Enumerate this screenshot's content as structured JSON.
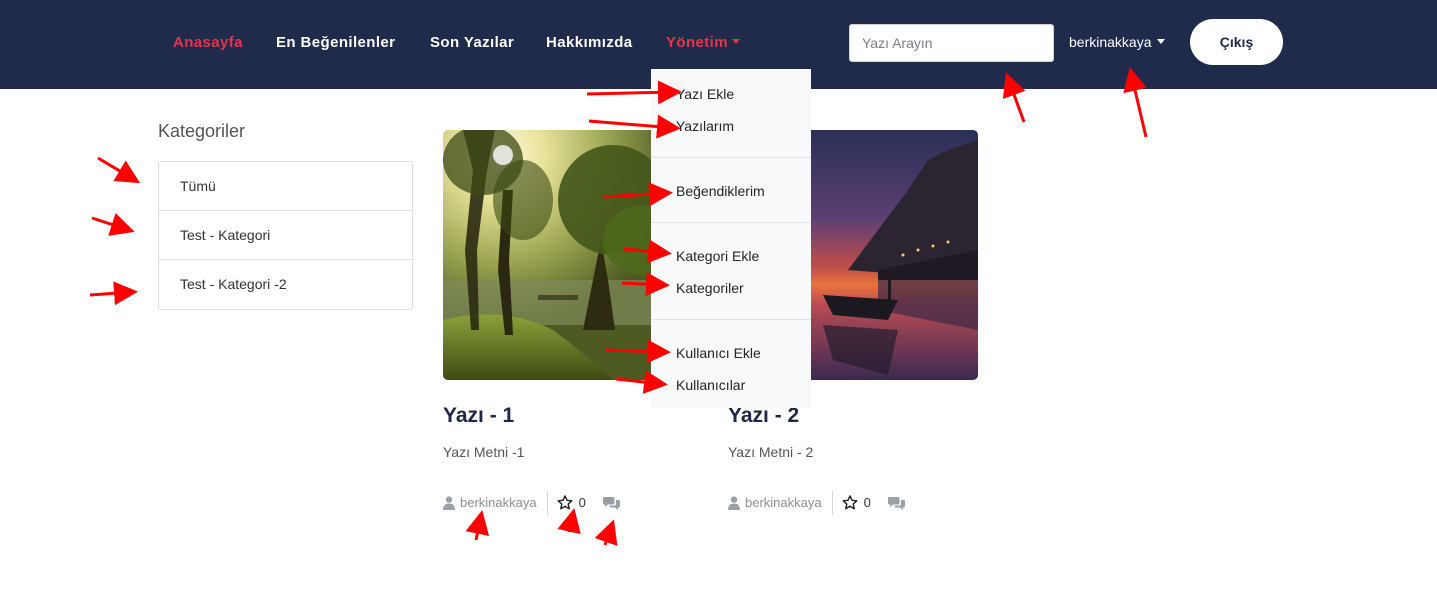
{
  "nav": {
    "items": [
      {
        "label": "Anasayfa",
        "active": true
      },
      {
        "label": "En Beğenilenler",
        "active": false
      },
      {
        "label": "Son Yazılar",
        "active": false
      },
      {
        "label": "Hakkımızda",
        "active": false
      },
      {
        "label": "Yönetim",
        "active": true,
        "dropdown": true
      }
    ],
    "search_placeholder": "Yazı Arayın",
    "username": "berkinakkaya",
    "logout_label": "Çıkış"
  },
  "admin_menu": {
    "groups": [
      [
        "Yazı Ekle",
        "Yazılarım"
      ],
      [
        "Beğendiklerim"
      ],
      [
        "Kategori Ekle",
        "Kategoriler"
      ],
      [
        "Kullanıcı Ekle",
        "Kullanıcılar"
      ]
    ]
  },
  "sidebar": {
    "title": "Kategoriler",
    "categories": [
      "Tümü",
      "Test - Kategori",
      "Test - Kategori -2"
    ]
  },
  "posts": [
    {
      "title": "Yazı - 1",
      "text": "Yazı Metni -1",
      "author": "berkinakkaya",
      "likes": "0",
      "image": "forest-sunlight-lake"
    },
    {
      "title": "Yazı - 2",
      "text": "Yazı Metni - 2",
      "author": "berkinakkaya",
      "likes": "0",
      "image": "sunset-lake-boat"
    }
  ],
  "icons": {
    "author": "user-icon",
    "likes": "star-outline-icon",
    "comments": "comments-icon",
    "dropdown": "caret-down-icon"
  },
  "colors": {
    "navbar": "#202a4a",
    "active_link": "#e8334a",
    "annotation_arrow": "#ff0000"
  }
}
